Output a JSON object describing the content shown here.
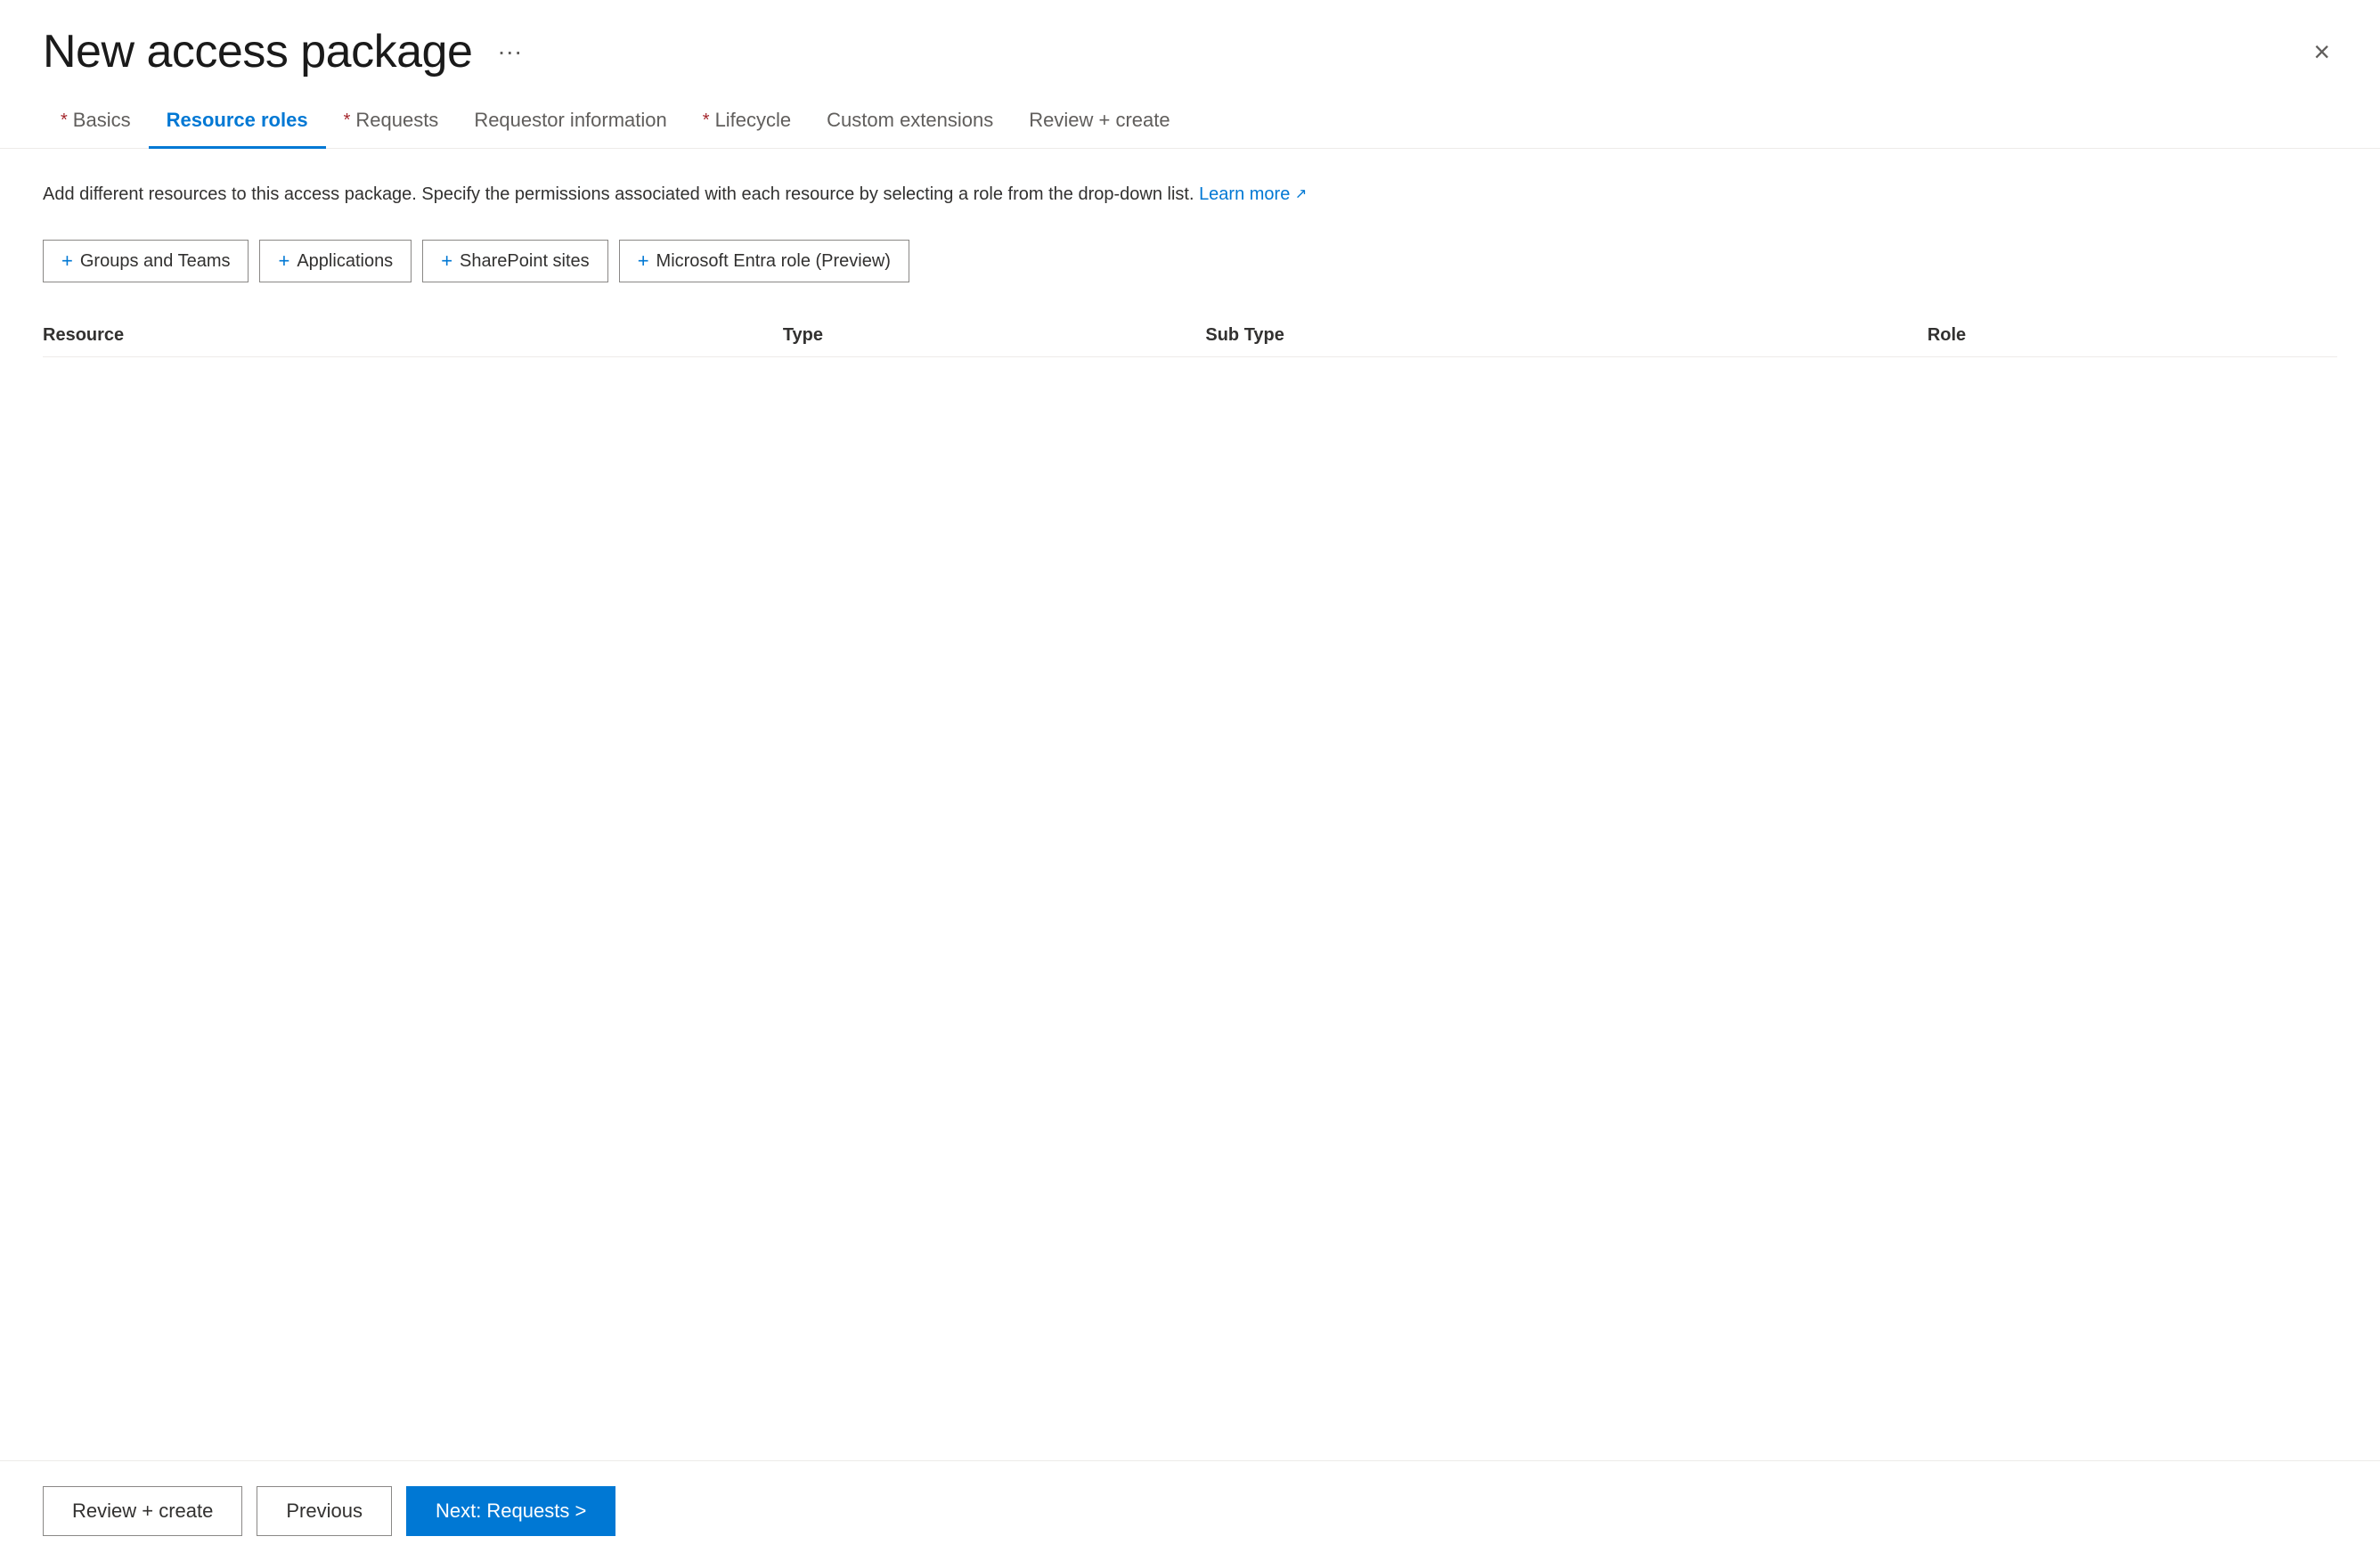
{
  "header": {
    "title": "New access package",
    "more_options_label": "···",
    "close_label": "×"
  },
  "tabs": [
    {
      "id": "basics",
      "label": "Basics",
      "required": true,
      "active": false
    },
    {
      "id": "resource-roles",
      "label": "Resource roles",
      "required": false,
      "active": true
    },
    {
      "id": "requests",
      "label": "Requests",
      "required": true,
      "active": false
    },
    {
      "id": "requestor-information",
      "label": "Requestor information",
      "required": false,
      "active": false
    },
    {
      "id": "lifecycle",
      "label": "Lifecycle",
      "required": true,
      "active": false
    },
    {
      "id": "custom-extensions",
      "label": "Custom extensions",
      "required": false,
      "active": false
    },
    {
      "id": "review-create",
      "label": "Review + create",
      "required": false,
      "active": false
    }
  ],
  "content": {
    "description": "Add different resources to this access package. Specify the permissions associated with each resource by selecting a role from the drop-down list.",
    "learn_more_text": "Learn more",
    "action_buttons": [
      {
        "id": "groups-teams",
        "label": "Groups and Teams"
      },
      {
        "id": "applications",
        "label": "Applications"
      },
      {
        "id": "sharepoint-sites",
        "label": "SharePoint sites"
      },
      {
        "id": "microsoft-entra-role",
        "label": "Microsoft Entra role (Preview)"
      }
    ],
    "table": {
      "columns": [
        {
          "id": "resource",
          "label": "Resource"
        },
        {
          "id": "type",
          "label": "Type"
        },
        {
          "id": "sub-type",
          "label": "Sub Type"
        },
        {
          "id": "role",
          "label": "Role"
        }
      ],
      "rows": []
    }
  },
  "footer": {
    "review_create_label": "Review + create",
    "previous_label": "Previous",
    "next_label": "Next: Requests >"
  }
}
